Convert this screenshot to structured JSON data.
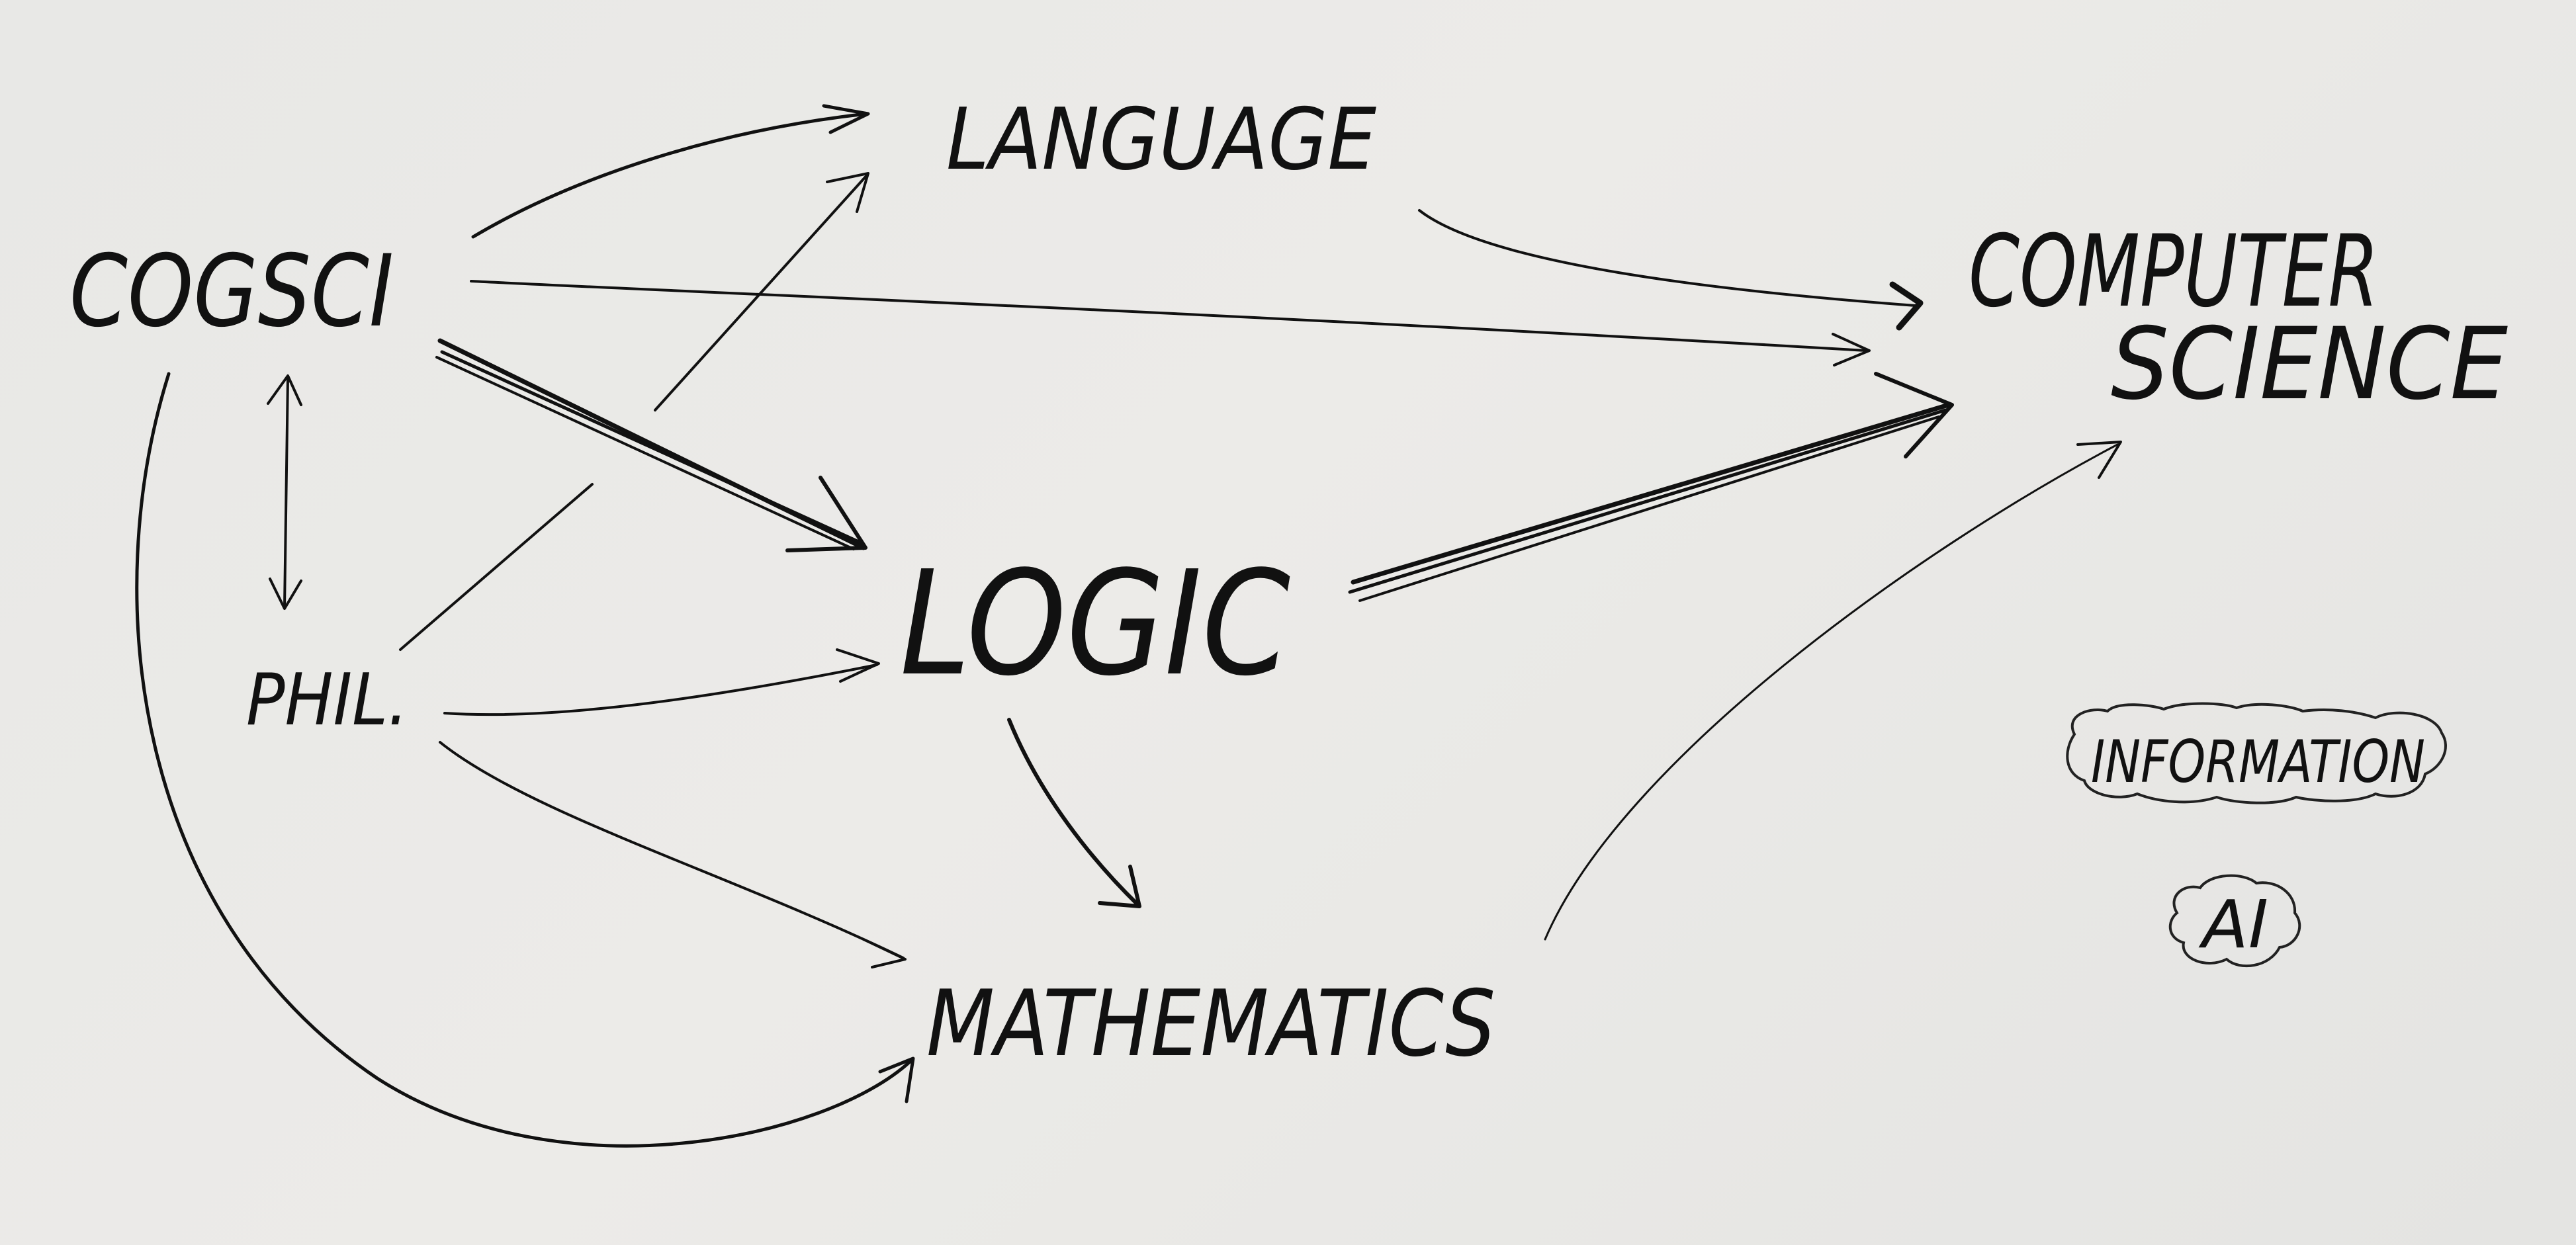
{
  "nodes": {
    "cogsci": "COGSCI",
    "language": "LANGUAGE",
    "computer_science_line1": "COMPUTER",
    "computer_science_line2": "SCIENCE",
    "logic": "LOGIC",
    "phil": "PHIL.",
    "mathematics": "MATHEMATICS",
    "information": "INFORMATION",
    "ai": "AI"
  },
  "edges": [
    {
      "from": "COGSCI",
      "to": "LANGUAGE"
    },
    {
      "from": "COGSCI",
      "to": "COMPUTER SCIENCE"
    },
    {
      "from": "COGSCI",
      "to": "LOGIC"
    },
    {
      "from": "COGSCI",
      "to": "PHIL.",
      "bidirectional": true
    },
    {
      "from": "COGSCI",
      "to": "MATHEMATICS"
    },
    {
      "from": "PHIL.",
      "to": "LANGUAGE"
    },
    {
      "from": "PHIL.",
      "to": "LOGIC"
    },
    {
      "from": "PHIL.",
      "to": "MATHEMATICS"
    },
    {
      "from": "LANGUAGE",
      "to": "COMPUTER SCIENCE"
    },
    {
      "from": "LOGIC",
      "to": "COMPUTER SCIENCE"
    },
    {
      "from": "LOGIC",
      "to": "MATHEMATICS"
    },
    {
      "from": "MATHEMATICS",
      "to": "COMPUTER SCIENCE"
    }
  ],
  "colors": {
    "ink": "#111111",
    "paper": "#e9e9e7"
  }
}
